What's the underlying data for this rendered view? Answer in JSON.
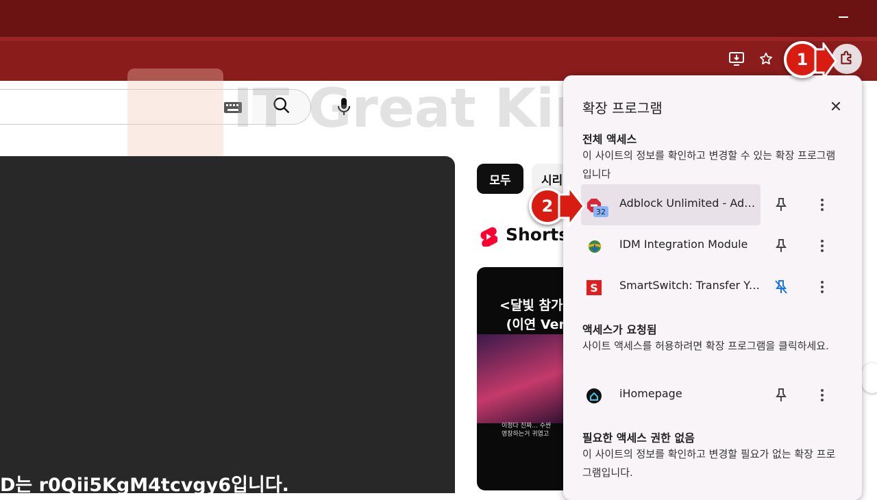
{
  "browser": {
    "toolbar_icons": [
      "install-app-icon",
      "bookmark-star-icon",
      "extensions-puzzle-icon"
    ]
  },
  "page": {
    "watermark_text": "IT Great King",
    "bottom_text": "D는 r0Qii5KgM4tcvgy6입니다.",
    "chips": [
      "모두",
      "시리"
    ],
    "shorts_title": "Shorts",
    "short_card": {
      "title": "<달빛 참가에\n(이연 Ver.",
      "caption": "이정다 진짜... 수싼\n영창하는거 귀엽고"
    }
  },
  "extensions_popup": {
    "title": "확장 프로그램",
    "close_label": "✕",
    "sections": {
      "full_access": {
        "heading": "전체 액세스",
        "description": "이 사이트의 정보를 확인하고 변경할 수 있는 확장 프로그램입니다"
      },
      "requested": {
        "heading": "액세스가 요청됨",
        "description": "사이트 액세스를 허용하려면 확장 프로그램을 클릭하세요."
      },
      "no_access": {
        "heading": "필요한 액세스 권한 없음",
        "description": "이 사이트의 정보를 확인하고 변경할 필요가 없는 확장 프로그램입니다."
      }
    },
    "items": [
      {
        "name": "Adblock Unlimited - Adbl...",
        "badge": "32",
        "pinned": false
      },
      {
        "name": "IDM Integration Module",
        "pinned": false
      },
      {
        "name": "SmartSwitch: Transfer You...",
        "pinned": true
      },
      {
        "name": "iHomepage",
        "pinned": false
      }
    ]
  },
  "markers": [
    "1",
    "2"
  ],
  "colors": {
    "titlebar": "#6b1212",
    "toolbar": "#8a1c1c",
    "marker": "#d81c12",
    "pin_active": "#1a73e8"
  }
}
